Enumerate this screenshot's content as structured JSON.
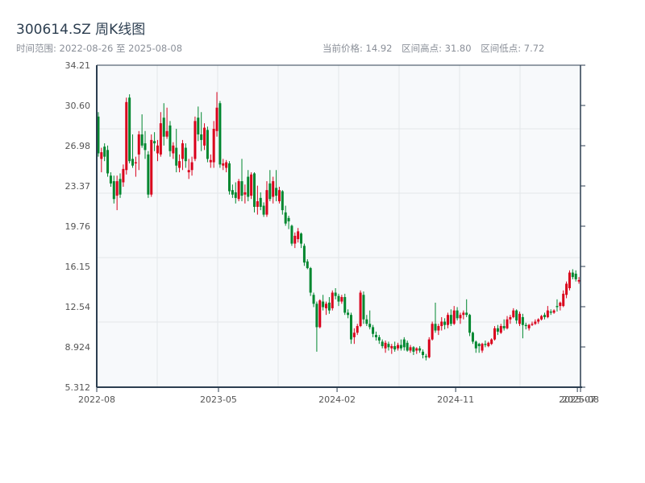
{
  "header": {
    "title": "300614.SZ 周K线图",
    "time_range": "时间范围: 2022-08-26 至 2025-08-08",
    "current_price": "当前价格: 14.92",
    "range_high": "区间高点: 31.80",
    "range_low": "区间低点: 7.72"
  },
  "chart_data": {
    "type": "candlestick",
    "title": "300614.SZ 周K线图",
    "interval": "weekly",
    "start_date": "2022-08-26",
    "end_date": "2025-08-08",
    "ylim": [
      5.312,
      34.21
    ],
    "y_ticks": [
      "34.21",
      "30.60",
      "26.98",
      "23.37",
      "19.76",
      "16.15",
      "12.54",
      "8.924",
      "5.312"
    ],
    "x_ticks": [
      "2022-08",
      "2023-05",
      "2024-02",
      "2024-11",
      "2025-07",
      "2025-08"
    ],
    "grid": true,
    "colors": {
      "up": "#d9001b",
      "down": "#00872f",
      "axis": "#2c3e50",
      "grid": "#e3e6ea",
      "plot_bg": "#f7f9fb"
    },
    "ohlc_order": [
      "open",
      "high",
      "low",
      "close"
    ],
    "candles": [
      [
        29.6,
        30.0,
        26.0,
        26.3
      ],
      [
        25.8,
        26.8,
        24.6,
        26.4
      ],
      [
        26.9,
        27.2,
        25.6,
        26.0
      ],
      [
        26.6,
        27.0,
        24.2,
        24.5
      ],
      [
        24.3,
        24.6,
        23.3,
        23.6
      ],
      [
        23.8,
        24.3,
        21.8,
        22.2
      ],
      [
        22.5,
        24.3,
        21.2,
        23.8
      ],
      [
        24.0,
        24.5,
        22.3,
        22.6
      ],
      [
        23.7,
        25.3,
        23.3,
        24.9
      ],
      [
        24.8,
        31.3,
        24.4,
        30.9
      ],
      [
        31.3,
        31.6,
        25.4,
        25.6
      ],
      [
        25.8,
        28.0,
        25.0,
        25.2
      ],
      [
        25.4,
        26.0,
        24.2,
        25.5
      ],
      [
        26.2,
        28.3,
        24.8,
        28.0
      ],
      [
        28.0,
        29.8,
        26.8,
        27.0
      ],
      [
        27.2,
        28.3,
        25.8,
        26.6
      ],
      [
        26.2,
        26.5,
        22.3,
        22.6
      ],
      [
        22.6,
        28.0,
        22.4,
        27.5
      ],
      [
        27.4,
        28.2,
        26.5,
        27.2
      ],
      [
        26.3,
        27.5,
        25.6,
        27.0
      ],
      [
        26.2,
        30.0,
        26.0,
        29.0
      ],
      [
        29.5,
        30.8,
        27.0,
        27.8
      ],
      [
        27.8,
        30.4,
        27.6,
        28.3
      ],
      [
        28.8,
        29.2,
        26.0,
        26.5
      ],
      [
        26.3,
        27.3,
        25.8,
        27.0
      ],
      [
        26.8,
        28.5,
        24.6,
        25.2
      ],
      [
        25.0,
        26.2,
        24.6,
        25.6
      ],
      [
        25.8,
        27.5,
        24.8,
        27.2
      ],
      [
        26.8,
        27.2,
        25.0,
        25.6
      ],
      [
        24.6,
        25.8,
        24.0,
        24.8
      ],
      [
        24.8,
        26.0,
        24.3,
        25.5
      ],
      [
        25.8,
        29.6,
        25.6,
        29.2
      ],
      [
        29.5,
        30.5,
        27.4,
        28.0
      ],
      [
        28.0,
        30.0,
        26.5,
        27.5
      ],
      [
        27.0,
        29.0,
        26.6,
        28.6
      ],
      [
        28.4,
        28.7,
        25.5,
        25.8
      ],
      [
        25.5,
        26.2,
        25.0,
        25.7
      ],
      [
        25.5,
        29.2,
        25.0,
        28.5
      ],
      [
        28.3,
        31.8,
        27.8,
        30.4
      ],
      [
        30.8,
        31.0,
        25.0,
        25.3
      ],
      [
        25.2,
        25.8,
        24.8,
        25.4
      ],
      [
        25.0,
        25.7,
        24.6,
        25.5
      ],
      [
        25.4,
        25.6,
        22.6,
        22.9
      ],
      [
        23.0,
        23.5,
        22.3,
        22.6
      ],
      [
        22.8,
        23.7,
        21.8,
        22.3
      ],
      [
        22.2,
        24.0,
        22.0,
        23.8
      ],
      [
        23.8,
        25.8,
        22.0,
        22.5
      ],
      [
        22.6,
        23.5,
        21.8,
        22.8
      ],
      [
        24.2,
        24.8,
        22.0,
        22.4
      ],
      [
        22.5,
        24.6,
        22.2,
        24.4
      ],
      [
        24.5,
        24.6,
        21.0,
        21.5
      ],
      [
        21.5,
        23.4,
        20.8,
        22.0
      ],
      [
        22.3,
        22.8,
        21.2,
        21.5
      ],
      [
        21.6,
        21.9,
        20.6,
        20.8
      ],
      [
        20.8,
        23.8,
        20.6,
        23.0
      ],
      [
        23.6,
        24.8,
        22.0,
        22.2
      ],
      [
        22.4,
        24.2,
        21.8,
        23.8
      ],
      [
        23.2,
        24.8,
        22.0,
        22.5
      ],
      [
        22.0,
        23.3,
        21.8,
        23.0
      ],
      [
        22.9,
        23.0,
        20.8,
        21.2
      ],
      [
        21.0,
        21.6,
        19.8,
        20.0
      ],
      [
        20.5,
        20.7,
        19.5,
        20.2
      ],
      [
        19.8,
        19.9,
        18.0,
        18.2
      ],
      [
        18.2,
        19.2,
        17.8,
        18.9
      ],
      [
        18.6,
        19.6,
        18.3,
        19.3
      ],
      [
        19.1,
        19.2,
        17.8,
        18.2
      ],
      [
        18.0,
        18.2,
        16.2,
        16.5
      ],
      [
        16.6,
        16.8,
        15.9,
        16.0
      ],
      [
        16.0,
        16.1,
        13.5,
        13.8
      ],
      [
        13.6,
        13.8,
        12.5,
        12.8
      ],
      [
        12.8,
        13.0,
        8.5,
        10.7
      ],
      [
        10.7,
        13.2,
        10.6,
        13.1
      ],
      [
        13.0,
        13.6,
        12.2,
        12.5
      ],
      [
        12.4,
        13.0,
        11.8,
        12.8
      ],
      [
        12.9,
        13.4,
        11.9,
        12.2
      ],
      [
        12.4,
        14.0,
        12.2,
        13.8
      ],
      [
        13.8,
        14.2,
        13.2,
        13.5
      ],
      [
        13.5,
        13.7,
        12.6,
        13.0
      ],
      [
        13.0,
        13.6,
        12.8,
        13.4
      ],
      [
        13.4,
        13.7,
        11.8,
        12.0
      ],
      [
        12.0,
        12.3,
        11.5,
        11.8
      ],
      [
        11.8,
        12.0,
        9.2,
        9.6
      ],
      [
        9.8,
        10.6,
        9.2,
        10.2
      ],
      [
        10.2,
        11.0,
        10.0,
        10.8
      ],
      [
        10.8,
        14.0,
        10.7,
        13.8
      ],
      [
        13.6,
        13.9,
        11.0,
        11.4
      ],
      [
        11.4,
        11.8,
        10.8,
        11.0
      ],
      [
        11.0,
        12.2,
        10.5,
        10.7
      ],
      [
        10.7,
        10.9,
        9.8,
        10.1
      ],
      [
        10.0,
        10.3,
        9.5,
        9.8
      ],
      [
        9.8,
        10.0,
        9.2,
        9.5
      ],
      [
        9.4,
        9.6,
        8.8,
        9.0
      ],
      [
        8.8,
        9.5,
        8.4,
        9.3
      ],
      [
        9.2,
        9.4,
        8.6,
        8.9
      ],
      [
        8.8,
        9.2,
        8.3,
        9.0
      ],
      [
        9.0,
        9.4,
        8.5,
        8.7
      ],
      [
        8.8,
        9.3,
        8.6,
        9.1
      ],
      [
        9.1,
        9.6,
        8.6,
        8.8
      ],
      [
        9.6,
        9.8,
        8.6,
        8.9
      ],
      [
        9.3,
        9.5,
        8.5,
        8.6
      ],
      [
        8.6,
        9.1,
        8.4,
        8.9
      ],
      [
        8.9,
        9.0,
        8.2,
        8.5
      ],
      [
        8.6,
        8.9,
        8.3,
        8.8
      ],
      [
        8.8,
        9.0,
        8.4,
        8.6
      ],
      [
        8.5,
        8.7,
        7.9,
        8.2
      ],
      [
        8.1,
        8.3,
        7.72,
        8.0
      ],
      [
        8.0,
        9.8,
        7.9,
        9.6
      ],
      [
        9.6,
        11.2,
        9.5,
        11.0
      ],
      [
        11.0,
        12.9,
        10.2,
        10.4
      ],
      [
        10.4,
        11.0,
        10.0,
        10.8
      ],
      [
        10.8,
        11.6,
        10.4,
        11.2
      ],
      [
        11.2,
        11.5,
        10.5,
        10.9
      ],
      [
        10.9,
        12.0,
        10.6,
        11.8
      ],
      [
        11.8,
        12.3,
        10.8,
        11.0
      ],
      [
        11.0,
        12.6,
        10.9,
        12.2
      ],
      [
        12.2,
        12.5,
        11.3,
        11.5
      ],
      [
        11.5,
        12.0,
        11.0,
        11.8
      ],
      [
        11.8,
        12.2,
        11.4,
        12.0
      ],
      [
        12.0,
        13.2,
        11.6,
        11.8
      ],
      [
        11.8,
        11.9,
        9.9,
        10.2
      ],
      [
        10.2,
        10.3,
        9.2,
        9.4
      ],
      [
        9.4,
        9.5,
        8.4,
        8.8
      ],
      [
        9.2,
        9.3,
        8.4,
        9.0
      ],
      [
        8.6,
        9.3,
        8.4,
        9.2
      ],
      [
        9.2,
        9.5,
        8.9,
        9.1
      ],
      [
        9.0,
        9.4,
        8.9,
        9.3
      ],
      [
        9.2,
        9.7,
        9.1,
        9.6
      ],
      [
        9.6,
        10.8,
        9.5,
        10.6
      ],
      [
        10.6,
        10.9,
        10.0,
        10.3
      ],
      [
        10.2,
        11.0,
        10.1,
        10.8
      ],
      [
        10.8,
        11.4,
        10.4,
        10.6
      ],
      [
        10.6,
        11.7,
        10.5,
        11.4
      ],
      [
        11.4,
        11.8,
        11.0,
        11.6
      ],
      [
        11.6,
        12.4,
        11.5,
        12.2
      ],
      [
        12.2,
        12.3,
        11.0,
        11.3
      ],
      [
        11.0,
        12.1,
        10.8,
        11.9
      ],
      [
        11.6,
        11.9,
        9.7,
        10.9
      ],
      [
        10.9,
        11.1,
        10.5,
        10.8
      ],
      [
        10.6,
        11.0,
        10.4,
        10.9
      ],
      [
        10.9,
        11.2,
        10.8,
        11.0
      ],
      [
        11.0,
        11.4,
        10.9,
        11.2
      ],
      [
        11.2,
        11.5,
        11.0,
        11.4
      ],
      [
        11.4,
        11.8,
        11.3,
        11.7
      ],
      [
        11.8,
        12.0,
        11.4,
        11.6
      ],
      [
        11.6,
        12.6,
        11.5,
        12.2
      ],
      [
        12.1,
        12.3,
        11.8,
        12.0
      ],
      [
        12.0,
        12.3,
        11.9,
        12.2
      ],
      [
        12.6,
        13.2,
        12.1,
        12.5
      ],
      [
        12.6,
        13.0,
        12.2,
        12.9
      ],
      [
        12.6,
        14.0,
        12.5,
        13.7
      ],
      [
        13.6,
        14.8,
        13.3,
        14.6
      ],
      [
        14.2,
        15.8,
        14.0,
        15.6
      ],
      [
        15.6,
        15.9,
        15.0,
        15.2
      ],
      [
        15.5,
        15.8,
        14.8,
        15.0
      ],
      [
        14.8,
        15.2,
        14.6,
        14.92
      ]
    ]
  }
}
